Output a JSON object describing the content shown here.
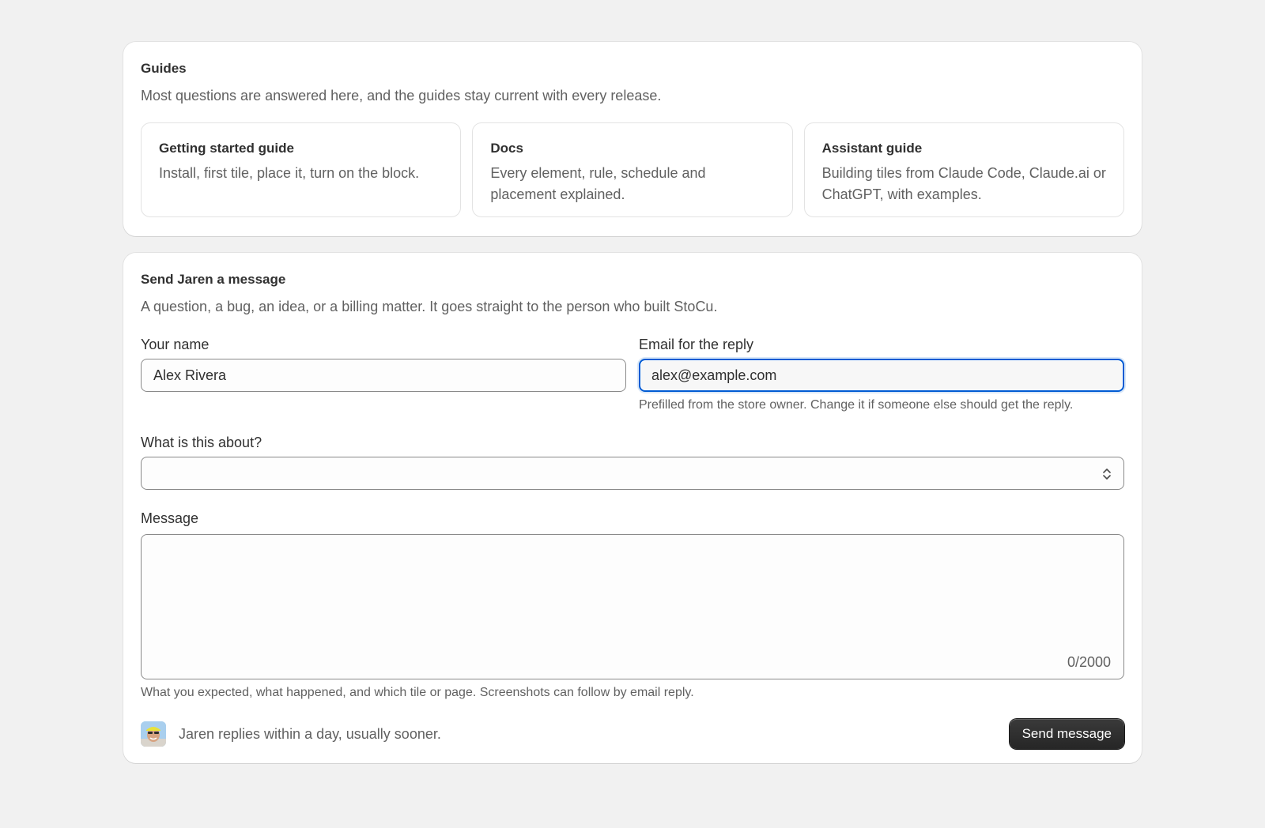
{
  "guides": {
    "title": "Guides",
    "subtitle": "Most questions are answered here, and the guides stay current with every release.",
    "items": [
      {
        "title": "Getting started guide",
        "description": "Install, first tile, place it, turn on the block."
      },
      {
        "title": "Docs",
        "description": "Every element, rule, schedule and placement explained."
      },
      {
        "title": "Assistant guide",
        "description": "Building tiles from Claude Code, Claude.ai or ChatGPT, with examples."
      }
    ]
  },
  "message_form": {
    "title": "Send Jaren a message",
    "subtitle": "A question, a bug, an idea, or a billing matter. It goes straight to the person who built StoCu.",
    "name": {
      "label": "Your name",
      "value": "Alex Rivera"
    },
    "email": {
      "label": "Email for the reply",
      "value": "alex@example.com",
      "help": "Prefilled from the store owner. Change it if someone else should get the reply."
    },
    "topic": {
      "label": "What is this about?",
      "selected": ""
    },
    "message": {
      "label": "Message",
      "value": "",
      "char_count": "0/2000",
      "help": "What you expected, what happened, and which tile or page. Screenshots can follow by email reply."
    },
    "reply_note": "Jaren replies within a day, usually sooner.",
    "send_label": "Send message"
  },
  "colors": {
    "background": "#f1f1f1",
    "card": "#ffffff",
    "focus_ring": "#005bd3",
    "primary_button": "#303030"
  }
}
